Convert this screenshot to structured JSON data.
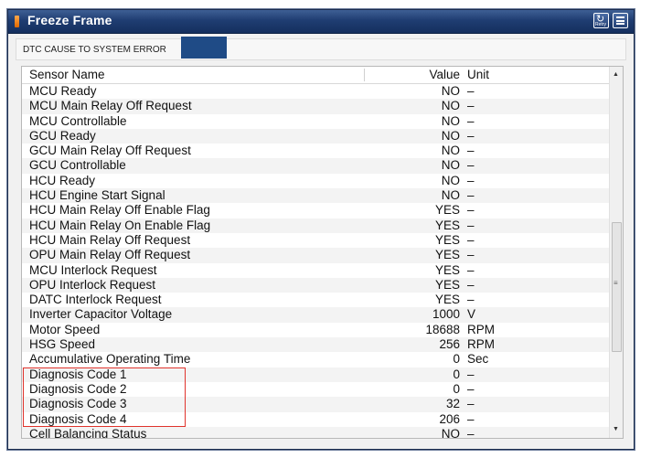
{
  "window": {
    "title": "Freeze Frame",
    "retry_label": "Retry"
  },
  "dtc": {
    "label": "DTC CAUSE TO SYSTEM ERROR"
  },
  "table": {
    "columns": {
      "name": "Sensor Name",
      "value": "Value",
      "unit": "Unit"
    },
    "rows": [
      {
        "name": "MCU Ready",
        "value": "NO",
        "unit": "–"
      },
      {
        "name": "MCU Main Relay Off Request",
        "value": "NO",
        "unit": "–"
      },
      {
        "name": "MCU Controllable",
        "value": "NO",
        "unit": "–"
      },
      {
        "name": "GCU Ready",
        "value": "NO",
        "unit": "–"
      },
      {
        "name": "GCU Main Relay Off Request",
        "value": "NO",
        "unit": "–"
      },
      {
        "name": "GCU Controllable",
        "value": "NO",
        "unit": "–"
      },
      {
        "name": "HCU Ready",
        "value": "NO",
        "unit": "–"
      },
      {
        "name": "HCU Engine Start Signal",
        "value": "NO",
        "unit": "–"
      },
      {
        "name": "HCU Main Relay Off Enable Flag",
        "value": "YES",
        "unit": "–"
      },
      {
        "name": "HCU Main Relay On Enable Flag",
        "value": "YES",
        "unit": "–"
      },
      {
        "name": "HCU Main Relay Off Request",
        "value": "YES",
        "unit": "–"
      },
      {
        "name": "OPU Main Relay Off Request",
        "value": "YES",
        "unit": "–"
      },
      {
        "name": "MCU Interlock Request",
        "value": "YES",
        "unit": "–"
      },
      {
        "name": "OPU Interlock Request",
        "value": "YES",
        "unit": "–"
      },
      {
        "name": "DATC Interlock Request",
        "value": "YES",
        "unit": "–"
      },
      {
        "name": "Inverter Capacitor Voltage",
        "value": "1000",
        "unit": "V"
      },
      {
        "name": "Motor Speed",
        "value": "18688",
        "unit": "RPM"
      },
      {
        "name": "HSG Speed",
        "value": "256",
        "unit": "RPM"
      },
      {
        "name": "Accumulative Operating Time",
        "value": "0",
        "unit": "Sec"
      },
      {
        "name": "Diagnosis Code 1",
        "value": "0",
        "unit": "–"
      },
      {
        "name": "Diagnosis Code 2",
        "value": "0",
        "unit": "–"
      },
      {
        "name": "Diagnosis Code 3",
        "value": "32",
        "unit": "–"
      },
      {
        "name": "Diagnosis Code 4",
        "value": "206",
        "unit": "–"
      },
      {
        "name": "Cell Balancing Status",
        "value": "NO",
        "unit": "–"
      }
    ]
  },
  "colors": {
    "titlebar": "#1f3d72",
    "dtc_badge": "#1f4b86",
    "highlight_box": "#e0332c"
  },
  "icons": {
    "retry": "retry-icon",
    "menu": "menu-icon",
    "scroll_up": "chevron-up-icon",
    "scroll_down": "chevron-down-icon"
  }
}
